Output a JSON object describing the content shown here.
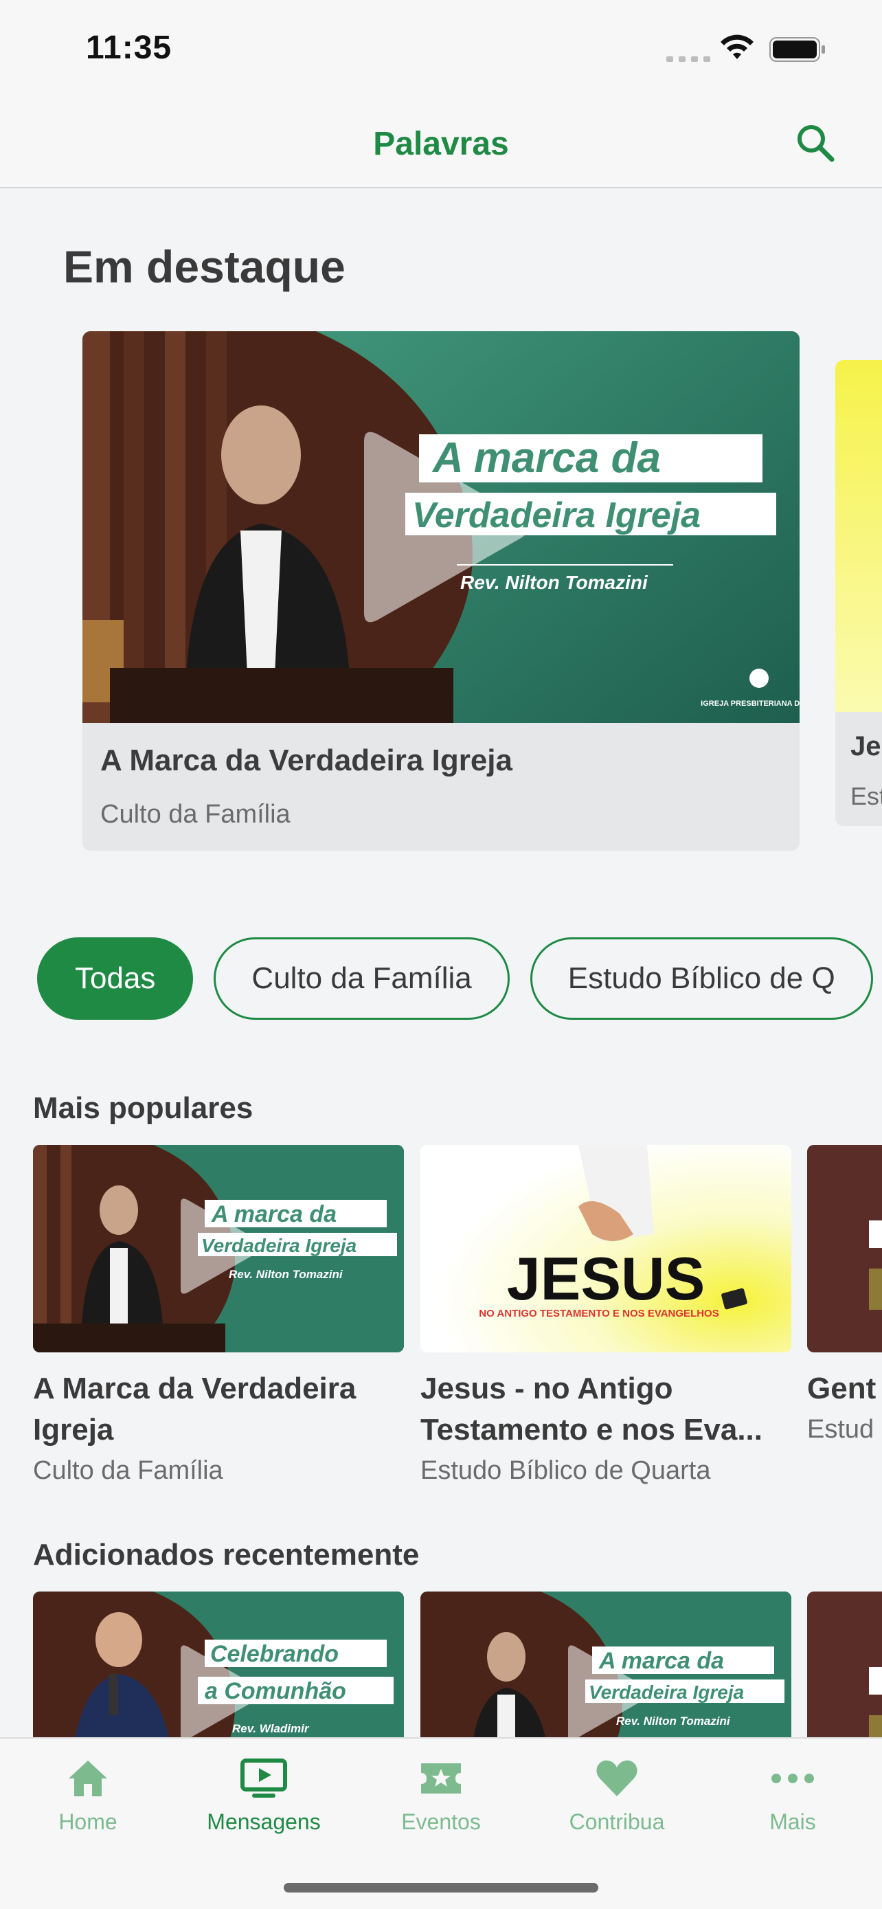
{
  "status_bar": {
    "time": "11:35"
  },
  "header": {
    "title": "Palavras"
  },
  "featured": {
    "title": "Em destaque",
    "items": [
      {
        "title": "A Marca da Verdadeira Igreja",
        "subtitle": "Culto da Família",
        "thumb_text": {
          "line1": "A marca da",
          "line2": "Verdadeira Igreja",
          "speaker": "Rev. Nilton Tomazini",
          "church": "IGREJA PRESBITERIANA DE LIMEIRA"
        }
      },
      {
        "title": "Je",
        "subtitle": "Est"
      }
    ]
  },
  "filters": [
    {
      "label": "Todas",
      "active": true
    },
    {
      "label": "Culto da Família",
      "active": false
    },
    {
      "label": "Estudo Bíblico de Q",
      "active": false
    }
  ],
  "popular": {
    "title": "Mais populares",
    "items": [
      {
        "title": "A Marca da Verdadeira Igreja",
        "subtitle": "Culto da Família",
        "thumb_text": {
          "line1": "A marca da",
          "line2": "Verdadeira Igreja",
          "speaker": "Rev. Nilton Tomazini"
        }
      },
      {
        "title": "Jesus - no Antigo Testamento e nos Eva...",
        "subtitle": "Estudo Bíblico de Quarta",
        "thumb_text": {
          "big": "JESUS",
          "small": "NO ANTIGO TESTAMENTO E NOS EVANGELHOS"
        }
      },
      {
        "title": "Gent",
        "subtitle": "Estud"
      }
    ]
  },
  "recent": {
    "title": "Adicionados recentemente",
    "items": [
      {
        "thumb_text": {
          "line1": "Celebrando",
          "line2": "a Comunhão",
          "speaker": "Rev. Wladimir"
        }
      },
      {
        "thumb_text": {
          "line1": "A marca da",
          "line2": "Verdadeira Igreja",
          "speaker": "Rev. Nilton Tomazini"
        }
      },
      {
        "thumb_text": {}
      }
    ]
  },
  "tabbar": {
    "items": [
      {
        "label": "Home",
        "icon": "home-icon",
        "active": false
      },
      {
        "label": "Mensagens",
        "icon": "tv-play-icon",
        "active": true
      },
      {
        "label": "Eventos",
        "icon": "ticket-star-icon",
        "active": false
      },
      {
        "label": "Contribua",
        "icon": "heart-icon",
        "active": false
      },
      {
        "label": "Mais",
        "icon": "more-dots-icon",
        "active": false
      }
    ]
  },
  "colors": {
    "accent": "#1f8a44",
    "accent_light": "#7dbb8f",
    "background": "#f3f4f6"
  }
}
